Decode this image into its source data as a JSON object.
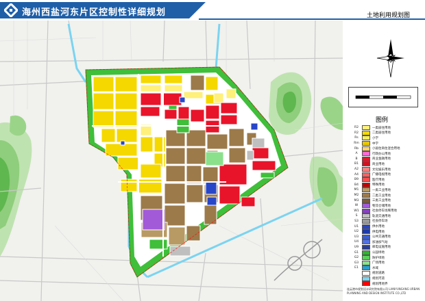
{
  "header": {
    "title": "海州西盐河东片区控制性详细规划",
    "subtitle": "土地利用规划图"
  },
  "sidebar": {
    "legend_title": "图例",
    "legend_items": [
      {
        "code": "R2",
        "label": "一类居住用地",
        "color": "#fef07a"
      },
      {
        "code": "R2",
        "label": "二类居住用地",
        "color": "#f5d800"
      },
      {
        "code": "Rs",
        "label": "小学",
        "color": "#f2ee5e"
      },
      {
        "code": "Rm",
        "label": "中学",
        "color": "#e8c800"
      },
      {
        "code": "Rb",
        "label": "小居住商住混合用地",
        "color": "#ffd36b"
      },
      {
        "code": "A",
        "label": "行政办公用地",
        "color": "#ff6ad5"
      },
      {
        "code": "B",
        "label": "商业金融用地",
        "color": "#e8142a"
      },
      {
        "code": "B1",
        "label": "商业用地",
        "color": "#d40f1f"
      },
      {
        "code": "A2",
        "label": "文化娱乐用地",
        "color": "#ff8080"
      },
      {
        "code": "A4",
        "label": "广播电视用地",
        "color": "#ff6060"
      },
      {
        "code": "B9",
        "label": "医疗用地",
        "color": "#ff4d4d"
      },
      {
        "code": "B4",
        "label": "特殊用地",
        "color": "#c00000"
      },
      {
        "code": "M1",
        "label": "一类工业用地",
        "color": "#b89a64"
      },
      {
        "code": "M2",
        "label": "二类工业用地",
        "color": "#9c7a4a"
      },
      {
        "code": "M3",
        "label": "三类工业用地",
        "color": "#7e5a36"
      },
      {
        "code": "W",
        "label": "物流仓储用地",
        "color": "#a25ad8"
      },
      {
        "code": "W1",
        "label": "社会停车场库用地",
        "color": "#8a3ec8"
      },
      {
        "code": "S",
        "label": "轨道交通用地",
        "color": "#bfbfbf"
      },
      {
        "code": "S3",
        "label": "社会停车场",
        "color": "#9c9c9c"
      },
      {
        "code": "U1",
        "label": "供水用地",
        "color": "#2846c8"
      },
      {
        "code": "U2",
        "label": "供电用地",
        "color": "#1c3aa8"
      },
      {
        "code": "U3",
        "label": "公共交通用地",
        "color": "#3a5ed8"
      },
      {
        "code": "U4",
        "label": "加油加气站",
        "color": "#4f72e8"
      },
      {
        "code": "U9",
        "label": "邮电设施用地",
        "color": "#2a3e90"
      },
      {
        "code": "G1",
        "label": "公园绿地",
        "color": "#2ab82a"
      },
      {
        "code": "G2",
        "label": "防护绿地",
        "color": "#5ad05a"
      },
      {
        "code": "G3",
        "label": "广场用地",
        "color": "#8be08b"
      },
      {
        "code": "E1",
        "label": "水域",
        "color": "#2a9fd0"
      },
      {
        "code": "",
        "label": "规划道路",
        "color": "#ffffff"
      },
      {
        "code": "",
        "label": "规划河道",
        "color": "#7ad4f0"
      },
      {
        "code": "",
        "label": "规划用地界",
        "color": "#ff0000"
      }
    ],
    "footer_text": "连云港市规划设计研究院有限公司 LIANYUNGANG URBAN PLANNING AND DESIGN INSTITUTE CO.,LTD"
  },
  "colors": {
    "title_band": "#1f5fa8",
    "residential": "#f5d800",
    "commercial": "#e8142a",
    "industrial": "#9c7a4a",
    "green": "#2ab82a",
    "water": "#7ad4f0",
    "storage": "#a25ad8",
    "utility": "#2846c8"
  }
}
